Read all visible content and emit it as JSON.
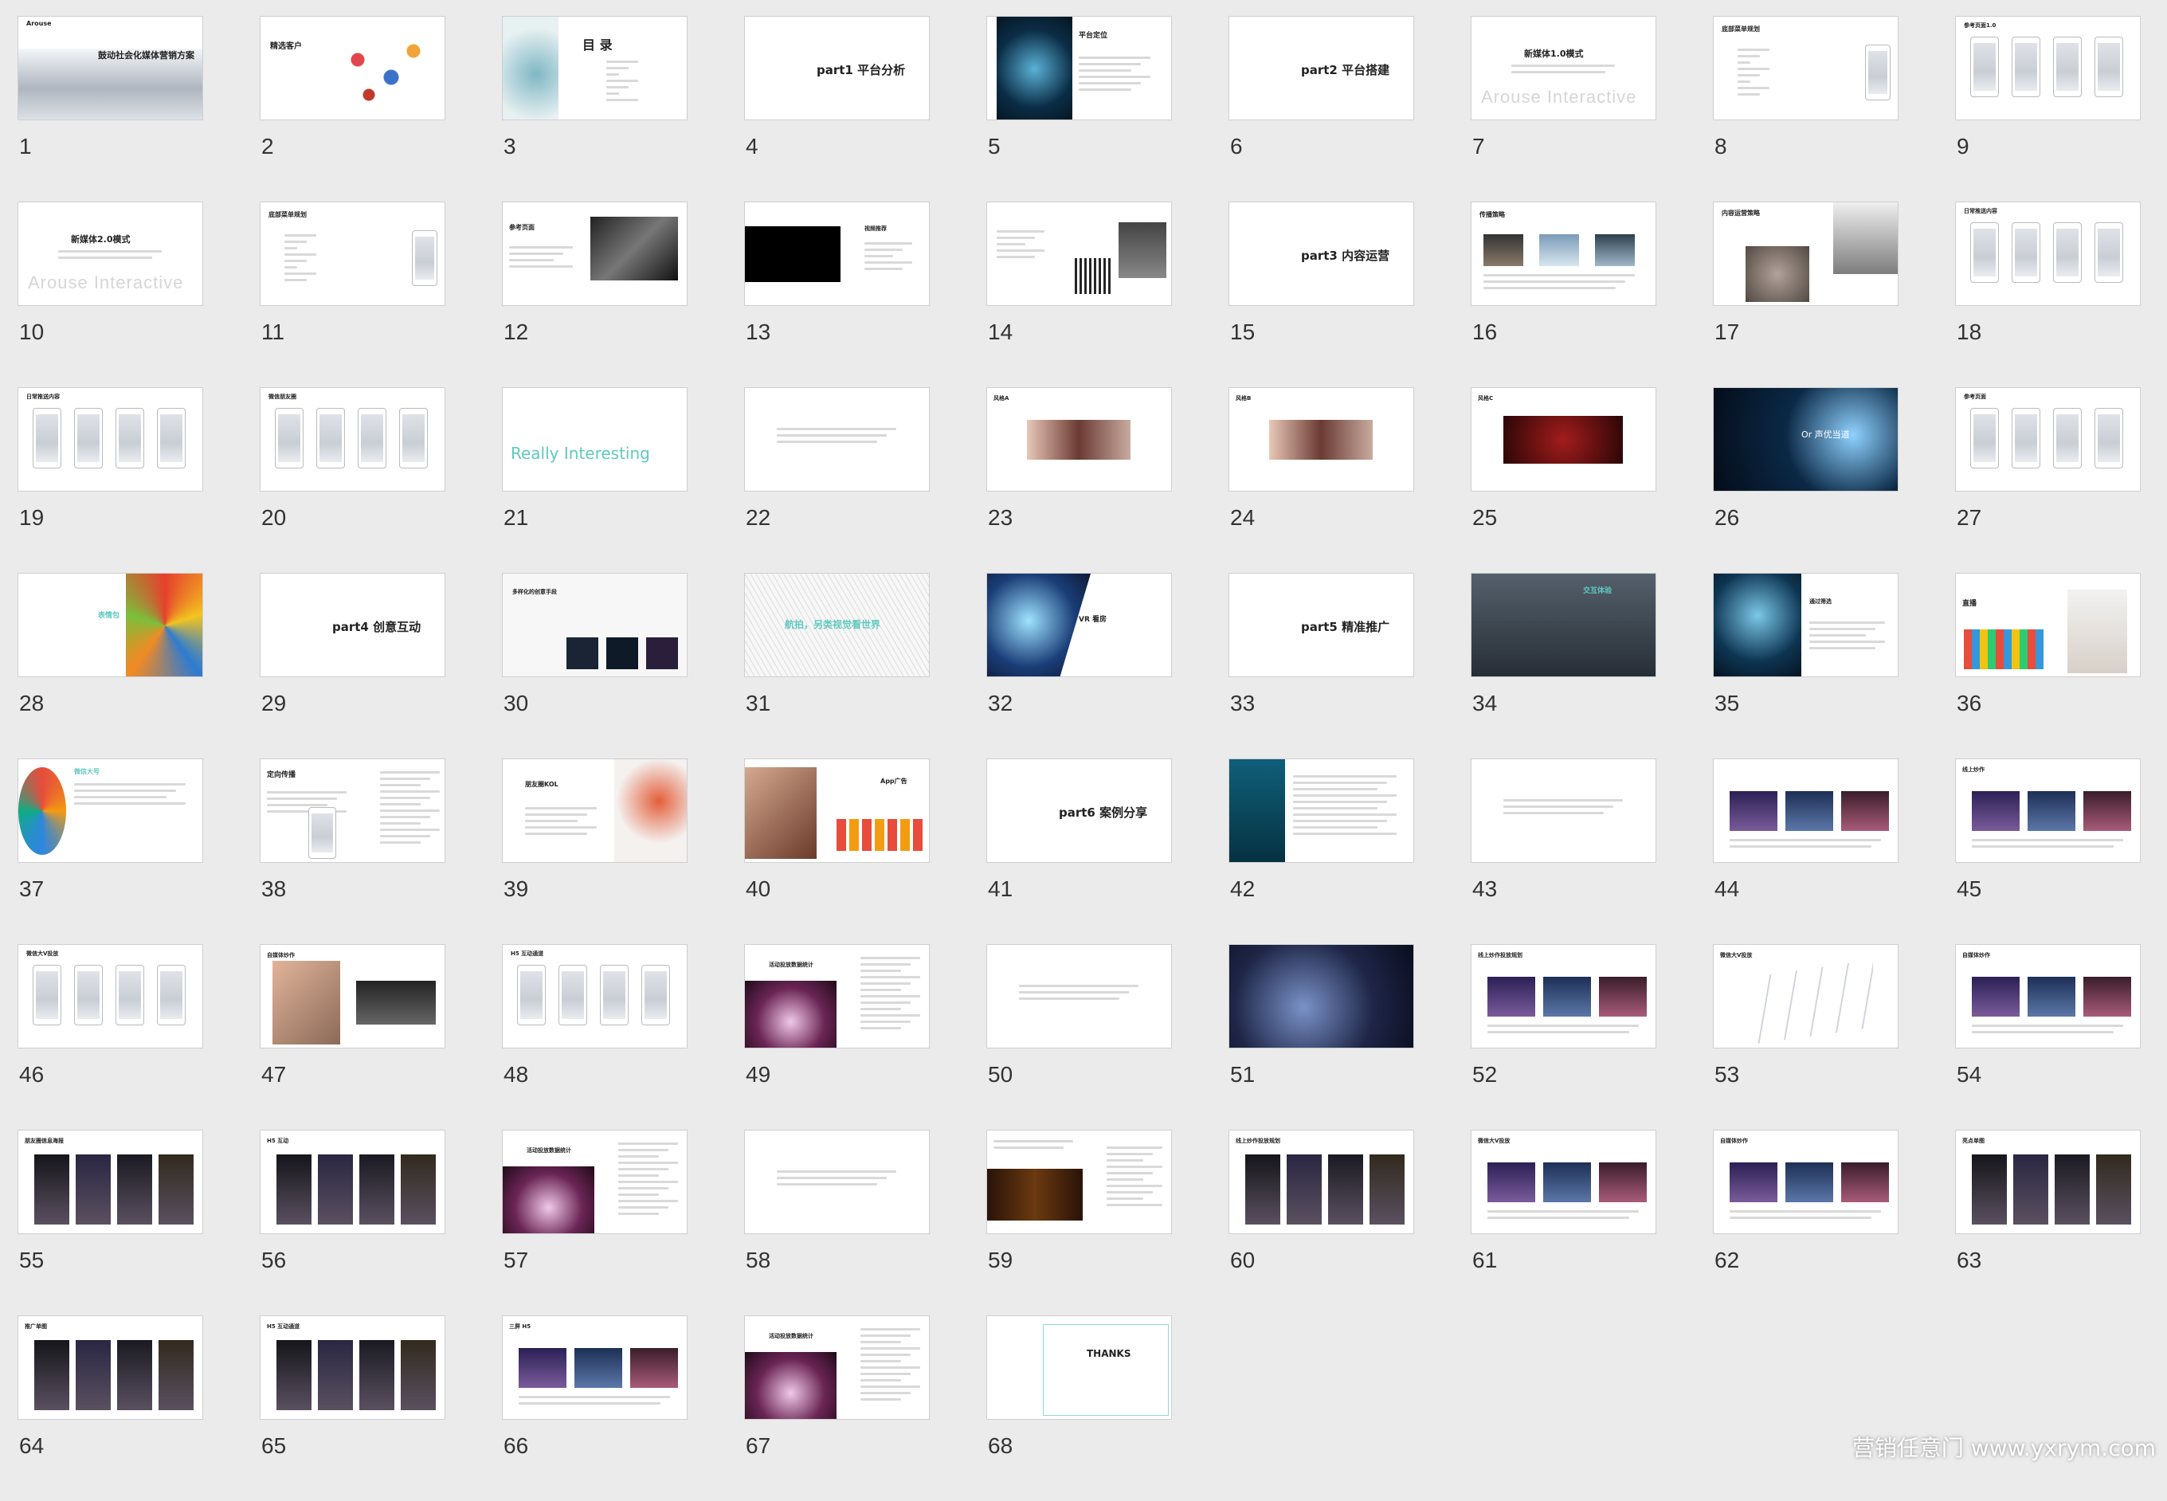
{
  "watermark": "营销任意门 www.yxrym.com",
  "colors": {
    "background": "#ebebeb",
    "accent": "#5fc9c0",
    "slide": "#ffffff",
    "dark": "#111111"
  },
  "slides": [
    {
      "n": "1",
      "kind": "cover",
      "title": "鼓动社会化媒体营销方案",
      "brand": "Arouse"
    },
    {
      "n": "2",
      "kind": "logos",
      "title": "精选客户"
    },
    {
      "n": "3",
      "kind": "toc",
      "title": "目 录"
    },
    {
      "n": "4",
      "kind": "part",
      "title": "part1 平台分析"
    },
    {
      "n": "5",
      "kind": "darkleft",
      "title": "平台定位"
    },
    {
      "n": "6",
      "kind": "part",
      "title": "part2 平台搭建"
    },
    {
      "n": "7",
      "kind": "mode",
      "title": "新媒体1.0模式",
      "brand": "Arouse Interactive"
    },
    {
      "n": "8",
      "kind": "menu",
      "title": "底部菜单规划"
    },
    {
      "n": "9",
      "kind": "phones",
      "title": "参考页面1.0"
    },
    {
      "n": "10",
      "kind": "mode",
      "title": "新媒体2.0模式",
      "brand": "Arouse Interactive"
    },
    {
      "n": "11",
      "kind": "menu",
      "title": "底部菜单规划"
    },
    {
      "n": "12",
      "kind": "photo",
      "title": "参考页面"
    },
    {
      "n": "13",
      "kind": "blackbox",
      "title": "视频推荐"
    },
    {
      "n": "14",
      "kind": "qr",
      "title": ""
    },
    {
      "n": "15",
      "kind": "part",
      "title": "part3 内容运营"
    },
    {
      "n": "16",
      "kind": "photos3",
      "title": "传播策略"
    },
    {
      "n": "17",
      "kind": "collage",
      "title": "内容运营策略"
    },
    {
      "n": "18",
      "kind": "phones",
      "title": "日常推送内容"
    },
    {
      "n": "19",
      "kind": "phones",
      "title": "日常推送内容"
    },
    {
      "n": "20",
      "kind": "phones",
      "title": "微信朋友圈"
    },
    {
      "n": "21",
      "kind": "really",
      "title": "Really Interesting"
    },
    {
      "n": "22",
      "kind": "quote",
      "title": ""
    },
    {
      "n": "23",
      "kind": "style",
      "title": "风格A"
    },
    {
      "n": "24",
      "kind": "style",
      "title": "风格B"
    },
    {
      "n": "25",
      "kind": "stylered",
      "title": "风格C"
    },
    {
      "n": "26",
      "kind": "darkhead",
      "title": "Or 声优当道"
    },
    {
      "n": "27",
      "kind": "phones",
      "title": "参考页面"
    },
    {
      "n": "28",
      "kind": "emoji",
      "title": "表情包"
    },
    {
      "n": "29",
      "kind": "part",
      "title": "part4 创意互动"
    },
    {
      "n": "30",
      "kind": "h5",
      "title": "多样化的创意手段"
    },
    {
      "n": "31",
      "kind": "lines",
      "title": "航拍，另类视觉看世界"
    },
    {
      "n": "32",
      "kind": "vr",
      "title": "VR 看房"
    },
    {
      "n": "33",
      "kind": "part",
      "title": "part5 精准推广"
    },
    {
      "n": "34",
      "kind": "darkgray",
      "title": "交互体验"
    },
    {
      "n": "35",
      "kind": "hand",
      "title": "通过筛选"
    },
    {
      "n": "36",
      "kind": "live",
      "title": "直播"
    },
    {
      "n": "37",
      "kind": "big",
      "title": "微信大号"
    },
    {
      "n": "38",
      "kind": "target",
      "title": "定向传播"
    },
    {
      "n": "39",
      "kind": "kol",
      "title": "朋友圈KOL"
    },
    {
      "n": "40",
      "kind": "app",
      "title": "App广告"
    },
    {
      "n": "41",
      "kind": "part",
      "title": "part6 案例分享"
    },
    {
      "n": "42",
      "kind": "ocean",
      "title": ""
    },
    {
      "n": "43",
      "kind": "quote",
      "title": ""
    },
    {
      "n": "44",
      "kind": "event",
      "title": ""
    },
    {
      "n": "45",
      "kind": "event",
      "title": "线上炒作"
    },
    {
      "n": "46",
      "kind": "phones",
      "title": "微信大V投放"
    },
    {
      "n": "47",
      "kind": "handphone",
      "title": "自媒体炒作"
    },
    {
      "n": "48",
      "kind": "phones",
      "title": "H5 互动通道"
    },
    {
      "n": "49",
      "kind": "stage",
      "title": "活动投放数据统计"
    },
    {
      "n": "50",
      "kind": "quote",
      "title": ""
    },
    {
      "n": "51",
      "kind": "concert",
      "title": ""
    },
    {
      "n": "52",
      "kind": "event",
      "title": "线上炒作投放规划"
    },
    {
      "n": "53",
      "kind": "papers",
      "title": "微信大V投放"
    },
    {
      "n": "54",
      "kind": "event",
      "title": "自媒体炒作"
    },
    {
      "n": "55",
      "kind": "posters",
      "title": "朋友圈信息海报"
    },
    {
      "n": "56",
      "kind": "posters",
      "title": "H5 互动"
    },
    {
      "n": "57",
      "kind": "stage",
      "title": "活动投放数据统计"
    },
    {
      "n": "58",
      "kind": "quote",
      "title": ""
    },
    {
      "n": "59",
      "kind": "darkbanner",
      "title": ""
    },
    {
      "n": "60",
      "kind": "posters",
      "title": "线上炒作投放规划"
    },
    {
      "n": "61",
      "kind": "event",
      "title": "微信大V投放"
    },
    {
      "n": "62",
      "kind": "event",
      "title": "自媒体炒作"
    },
    {
      "n": "63",
      "kind": "posters",
      "title": "亮点单图"
    },
    {
      "n": "64",
      "kind": "posters",
      "title": "推广单图"
    },
    {
      "n": "65",
      "kind": "posters",
      "title": "H5 互动通道"
    },
    {
      "n": "66",
      "kind": "event",
      "title": "三屏 H5"
    },
    {
      "n": "67",
      "kind": "stage",
      "title": "活动投放数据统计"
    },
    {
      "n": "68",
      "kind": "thanks",
      "title": "THANKS"
    }
  ]
}
